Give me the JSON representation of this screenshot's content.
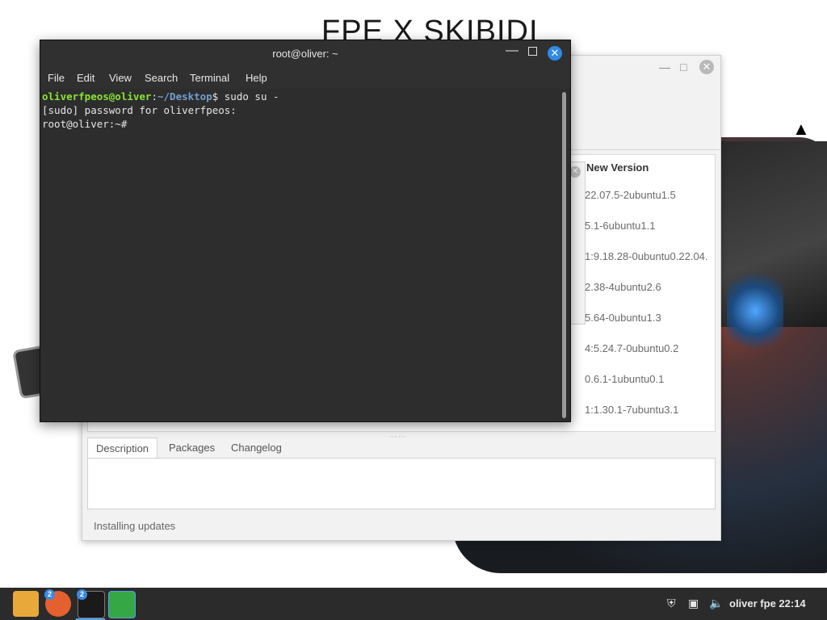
{
  "wallpaper": {
    "title": "FPE X SKIBIDI"
  },
  "update_manager": {
    "column_header": "New Version",
    "versions": [
      "22.07.5-2ubuntu1.5",
      "5.1-6ubuntu1.1",
      "1:9.18.28-0ubuntu0.22.04.",
      "2.38-4ubuntu2.6",
      "5.64-0ubuntu1.3",
      "4:5.24.7-0ubuntu0.2",
      "0.6.1-1ubuntu0.1",
      "1:1.30.1-7ubuntu3.1"
    ],
    "tabs": [
      "Description",
      "Packages",
      "Changelog"
    ],
    "status": "Installing updates"
  },
  "terminal": {
    "title": "root@oliver: ~",
    "menu": [
      "File",
      "Edit",
      "View",
      "Search",
      "Terminal",
      "Help"
    ],
    "prompt_user": "oliverfpeos@oliver",
    "prompt_sep": ":",
    "prompt_path": "~/Desktop",
    "command_line": "$ sudo su -",
    "line2": "[sudo] password for oliverfpeos:",
    "line3": "root@oliver:~#"
  },
  "taskbar": {
    "badges": [
      "2",
      "2"
    ],
    "clock": "oliver fpe 22:14",
    "accent": "#3c8be0"
  }
}
